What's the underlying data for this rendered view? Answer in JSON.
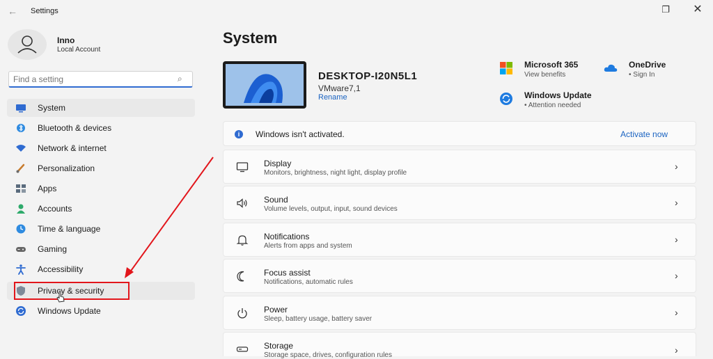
{
  "window": {
    "title": "Settings",
    "back_glyph": "←",
    "restore_glyph": "❐",
    "close_glyph": "✕"
  },
  "profile": {
    "name": "Inno",
    "account_type": "Local Account",
    "icon": "person-icon"
  },
  "search": {
    "placeholder": "Find a setting",
    "icon": "search-icon"
  },
  "sidebar": {
    "items": [
      {
        "label": "System",
        "icon": "monitor-icon",
        "color": "#2f6bd1"
      },
      {
        "label": "Bluetooth & devices",
        "icon": "bluetooth-icon",
        "color": "#2f8be0"
      },
      {
        "label": "Network & internet",
        "icon": "wifi-icon",
        "color": "#2f6bd1"
      },
      {
        "label": "Personalization",
        "icon": "brush-icon",
        "color": "#c77b2d"
      },
      {
        "label": "Apps",
        "icon": "apps-icon",
        "color": "#5a6b7d"
      },
      {
        "label": "Accounts",
        "icon": "person-icon",
        "color": "#2eaa6b"
      },
      {
        "label": "Time & language",
        "icon": "globe-clock-icon",
        "color": "#2f8be0"
      },
      {
        "label": "Gaming",
        "icon": "gamepad-icon",
        "color": "#666666"
      },
      {
        "label": "Accessibility",
        "icon": "accessibility-icon",
        "color": "#2f6bd1"
      },
      {
        "label": "Privacy & security",
        "icon": "shield-icon",
        "color": "#7d8a99"
      },
      {
        "label": "Windows Update",
        "icon": "sync-icon",
        "color": "#2f6bd1"
      }
    ]
  },
  "main": {
    "title": "System",
    "device": {
      "name": "DESKTOP-I20N5L1",
      "model": "VMware7,1",
      "rename_label": "Rename"
    },
    "quick_links": [
      {
        "title": "Microsoft 365",
        "subtitle": "View benefits",
        "icon": "microsoft-logo-icon"
      },
      {
        "title": "OneDrive",
        "subtitle": "• Sign In",
        "icon": "cloud-icon"
      },
      {
        "title": "Windows Update",
        "subtitle": "• Attention needed",
        "icon": "sync-icon"
      }
    ],
    "activation": {
      "message": "Windows isn't activated.",
      "action": "Activate now",
      "icon_glyph": "i"
    },
    "settings": [
      {
        "title": "Display",
        "subtitle": "Monitors, brightness, night light, display profile",
        "icon": "display-icon"
      },
      {
        "title": "Sound",
        "subtitle": "Volume levels, output, input, sound devices",
        "icon": "speaker-icon"
      },
      {
        "title": "Notifications",
        "subtitle": "Alerts from apps and system",
        "icon": "bell-icon"
      },
      {
        "title": "Focus assist",
        "subtitle": "Notifications, automatic rules",
        "icon": "moon-icon"
      },
      {
        "title": "Power",
        "subtitle": "Sleep, battery usage, battery saver",
        "icon": "power-icon"
      },
      {
        "title": "Storage",
        "subtitle": "Storage space, drives, configuration rules",
        "icon": "storage-icon"
      }
    ],
    "chevron_glyph": "›"
  },
  "colors": {
    "accent": "#2f6bd1",
    "link": "#1a63c1",
    "annotation": "#e2151b"
  }
}
